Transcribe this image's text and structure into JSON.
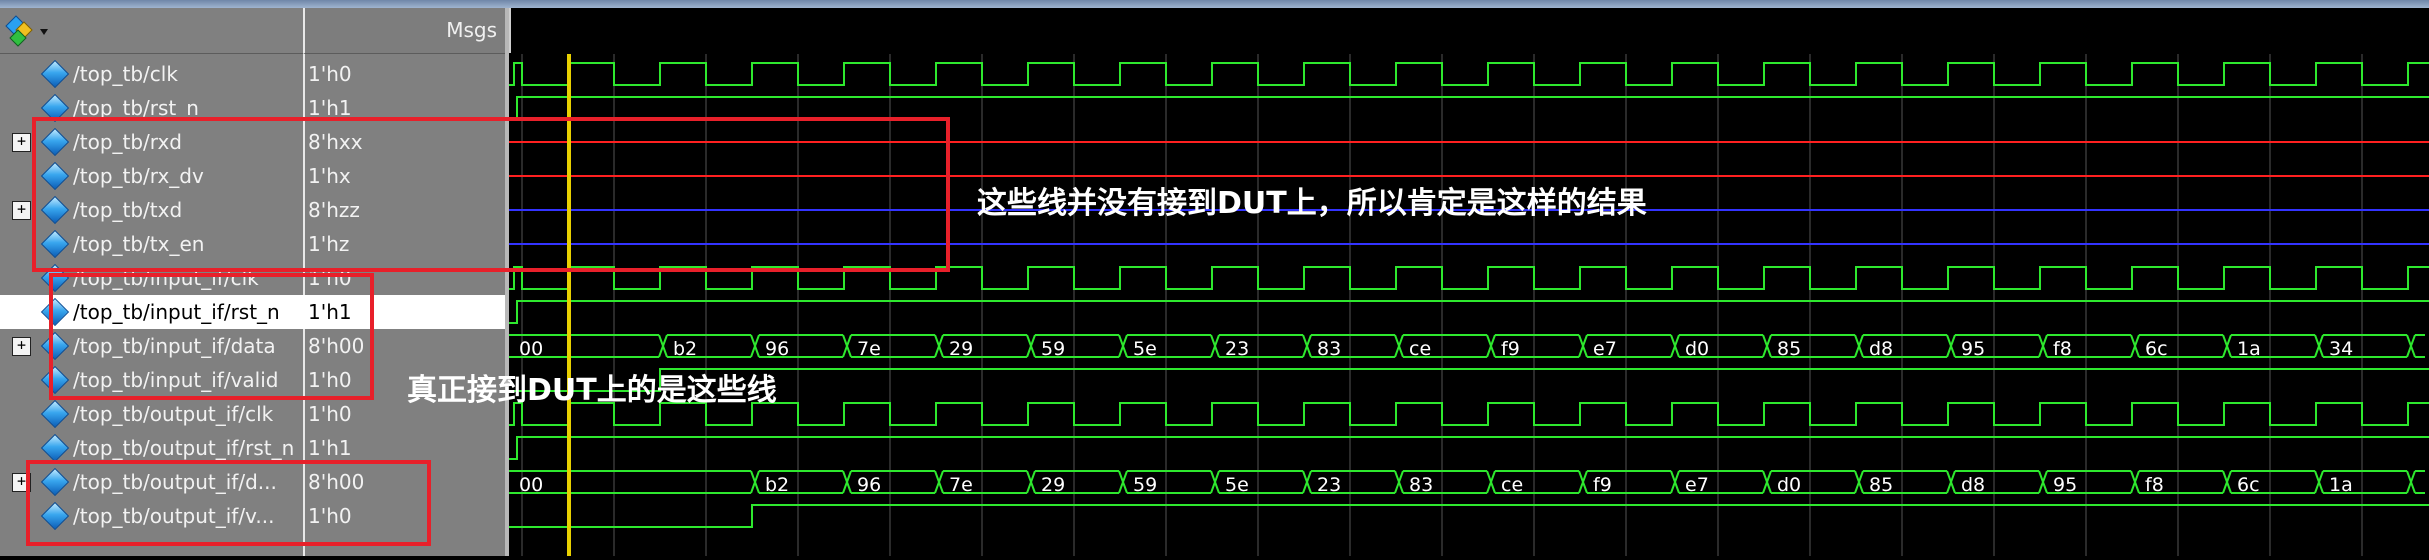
{
  "header": {
    "msgs_label": "Msgs"
  },
  "signals": [
    {
      "name": "/top_tb/clk",
      "value": "1'h0",
      "expandable": false
    },
    {
      "name": "/top_tb/rst_n",
      "value": "1'h1",
      "expandable": false
    },
    {
      "name": "/top_tb/rxd",
      "value": "8'hxx",
      "expandable": true
    },
    {
      "name": "/top_tb/rx_dv",
      "value": "1'hx",
      "expandable": false
    },
    {
      "name": "/top_tb/txd",
      "value": "8'hzz",
      "expandable": true
    },
    {
      "name": "/top_tb/tx_en",
      "value": "1'hz",
      "expandable": false
    },
    {
      "name": "/top_tb/input_if/clk",
      "value": "1'h0",
      "expandable": false
    },
    {
      "name": "/top_tb/input_if/rst_n",
      "value": "1'h1",
      "expandable": false,
      "selected": true
    },
    {
      "name": "/top_tb/input_if/data",
      "value": "8'h00",
      "expandable": true
    },
    {
      "name": "/top_tb/input_if/valid",
      "value": "1'h0",
      "expandable": false
    },
    {
      "name": "/top_tb/output_if/clk",
      "value": "1'h0",
      "expandable": false
    },
    {
      "name": "/top_tb/output_if/rst_n",
      "value": "1'h1",
      "expandable": false
    },
    {
      "name": "/top_tb/output_if/d...",
      "value": "8'h00",
      "expandable": true
    },
    {
      "name": "/top_tb/output_if/v...",
      "value": "1'h0",
      "expandable": false
    }
  ],
  "bus_values": {
    "input_data": [
      "00",
      "b2",
      "96",
      "7e",
      "29",
      "59",
      "5e",
      "23",
      "83",
      "ce",
      "f9",
      "e7",
      "d0",
      "85",
      "d8",
      "95",
      "f8",
      "6c",
      "1a",
      "34"
    ],
    "output_data": [
      "00",
      "b2",
      "96",
      "7e",
      "29",
      "59",
      "5e",
      "23",
      "83",
      "ce",
      "f9",
      "e7",
      "d0",
      "85",
      "d8",
      "95",
      "f8",
      "6c",
      "1a"
    ]
  },
  "annotations": {
    "unconnected": "这些线并没有接到DUT上，所以肯定是这样的结果",
    "connected": "真正接到DUT上的是这些线"
  },
  "colors": {
    "wave_green": "#2ee82e",
    "wave_red": "#ff2020",
    "wave_blue": "#3333ff",
    "cursor": "#e8d000",
    "grid": "#555555",
    "annotation_box": "#e8202a"
  }
}
